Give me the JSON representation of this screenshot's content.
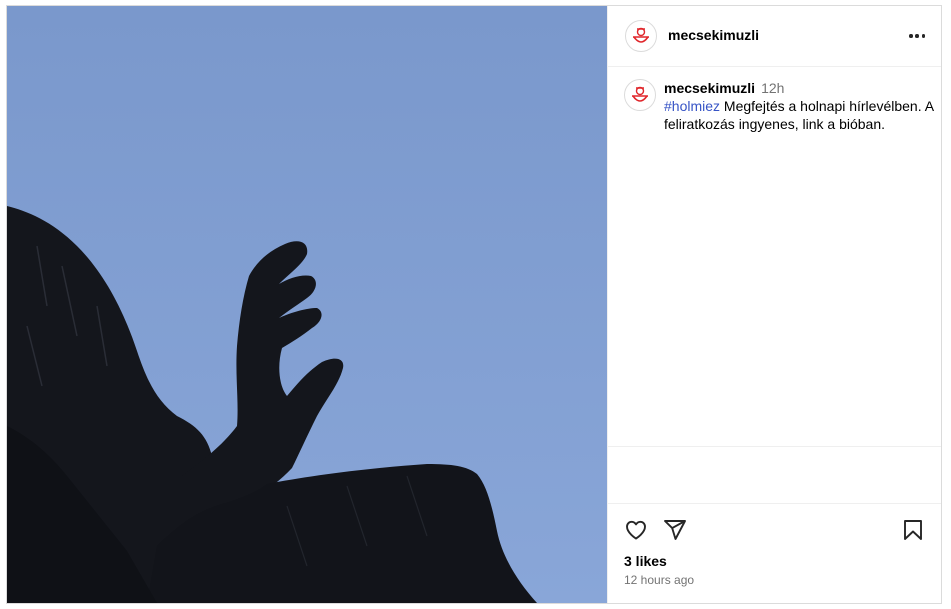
{
  "post": {
    "username": "mecsekimuzli",
    "image_description": "",
    "more_options_icon": "three-dots-icon"
  },
  "caption": {
    "username": "mecsekimuzli",
    "time": "12h",
    "hashtag": "#holmiez",
    "text": " Megfejtés a holnapi hírlevélben. A feliratkozás ingyenes, link a bióban."
  },
  "actions": {
    "like_icon": "heart-outline-icon",
    "share_icon": "paper-plane-icon",
    "save_icon": "bookmark-outline-icon",
    "likes": "3 likes",
    "posted_ago": "12 hours ago"
  },
  "colors": {
    "sky": "#7c9bcf",
    "silhouette": "#14161c",
    "hashtag": "#3754c6",
    "avatar_red": "#e0262b"
  }
}
